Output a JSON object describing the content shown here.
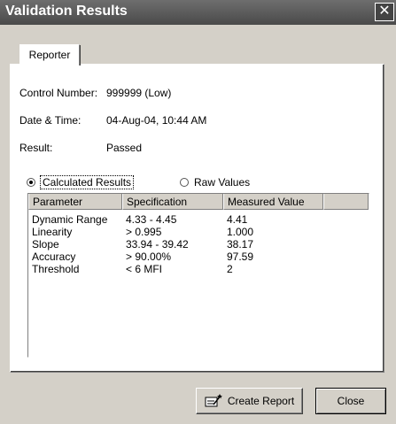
{
  "window": {
    "title": "Validation Results",
    "close_glyph": "✕"
  },
  "tabs": [
    {
      "label": "Reporter"
    }
  ],
  "info": [
    {
      "label": "Control Number:",
      "value": "999999 (Low)"
    },
    {
      "label": "Date & Time:",
      "value": "04-Aug-04, 10:44 AM"
    },
    {
      "label": "Result:",
      "value": "Passed"
    }
  ],
  "view": {
    "calculated_label": "Calculated Results",
    "raw_label": "Raw Values",
    "selected": "calculated"
  },
  "table": {
    "headers": [
      "Parameter",
      "Specification",
      "Measured Value"
    ],
    "rows": [
      [
        "Dynamic Range",
        "4.33 - 4.45",
        "4.41"
      ],
      [
        "Linearity",
        "> 0.995",
        "1.000"
      ],
      [
        "Slope",
        "33.94 - 39.42",
        "38.17"
      ],
      [
        "Accuracy",
        "> 90.00%",
        "97.59"
      ],
      [
        "Threshold",
        "< 6 MFI",
        "2"
      ]
    ]
  },
  "buttons": {
    "create_report": "Create Report",
    "close": "Close"
  },
  "icons": {
    "create_report_icon": "report-wand-icon"
  }
}
